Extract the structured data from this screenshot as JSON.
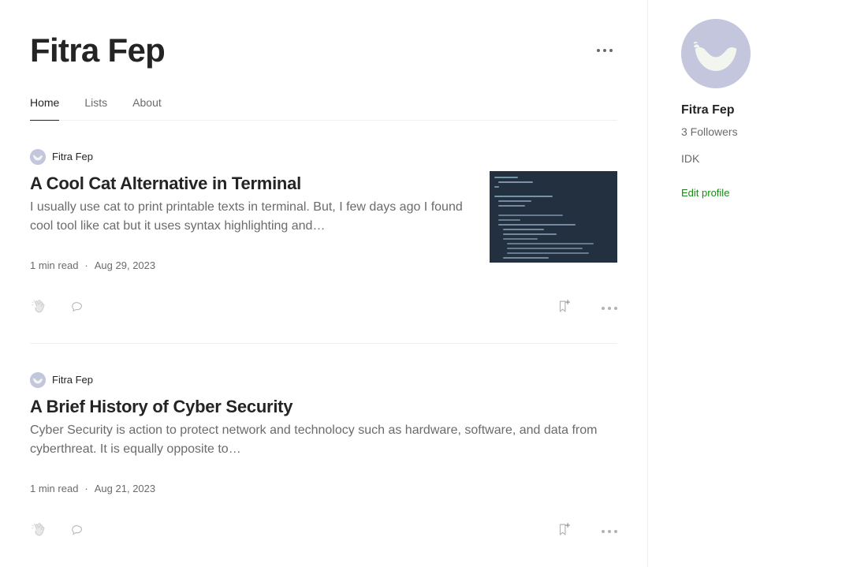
{
  "colors": {
    "accent_green": "#1a8917",
    "text_primary": "#242424",
    "text_secondary": "#6b6b6b",
    "divider": "#f0f0f0",
    "avatar_bg": "#c3c6dd",
    "thumb_bg": "#223040"
  },
  "profile": {
    "name": "Fitra Fep",
    "more_label": "More options"
  },
  "tabs": [
    {
      "label": "Home",
      "active": true
    },
    {
      "label": "Lists",
      "active": false
    },
    {
      "label": "About",
      "active": false
    }
  ],
  "articles": [
    {
      "author": "Fitra Fep",
      "title": "A Cool Cat Alternative in Terminal",
      "excerpt": "I usually use cat to print printable texts in terminal. But, I few days ago I found cool tool like cat but it uses syntax highlighting and…",
      "read_time": "1 min read",
      "separator": "·",
      "date": "Aug 29, 2023",
      "has_thumbnail": true,
      "thumbnail_alt": "dark terminal screenshot with dart code"
    },
    {
      "author": "Fitra Fep",
      "title": "A Brief History of Cyber Security",
      "excerpt": "Cyber Security is action to protect network and technolocy such as hardware, software, and data from cyberthreat. It is equally opposite to…",
      "read_time": "1 min read",
      "separator": "·",
      "date": "Aug 21, 2023",
      "has_thumbnail": false,
      "thumbnail_alt": ""
    }
  ],
  "action_icons": {
    "clap": "clap-icon",
    "comment": "comment-icon",
    "bookmark": "bookmark-add-icon",
    "more": "more-options-icon"
  },
  "sidebar": {
    "name": "Fitra Fep",
    "followers": "3 Followers",
    "bio": "IDK",
    "edit_profile": "Edit profile"
  }
}
